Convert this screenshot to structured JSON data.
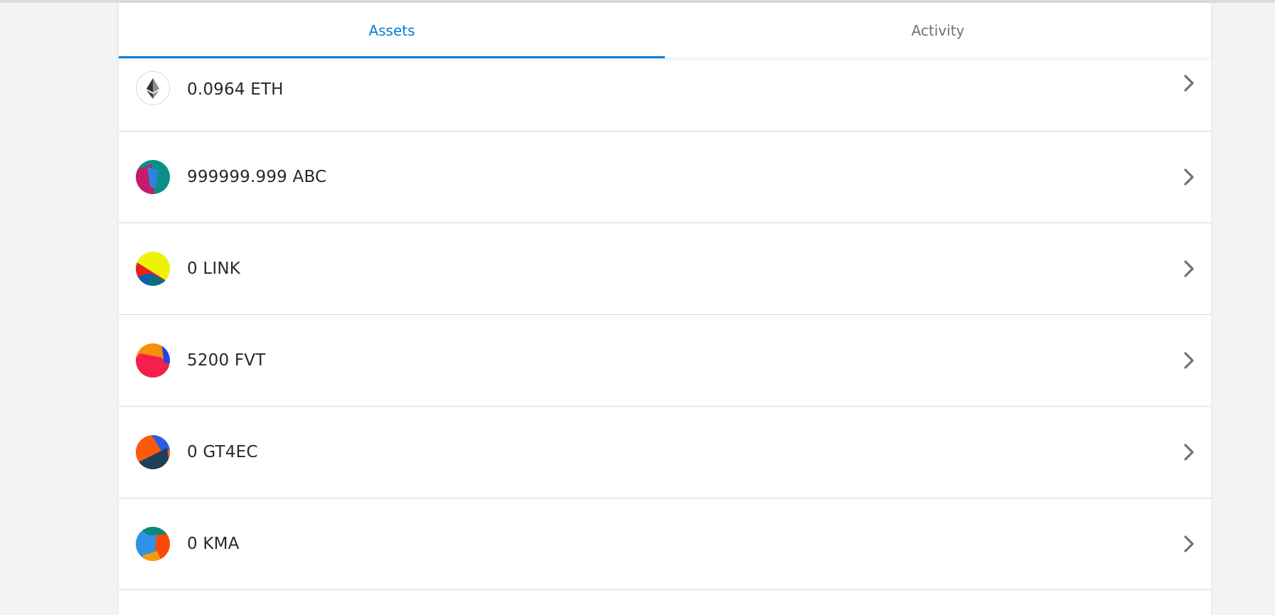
{
  "tabs": {
    "assets": "Assets",
    "activity": "Activity"
  },
  "assets": [
    {
      "amount": "0.0964 ETH",
      "icon": "ethereum-icon"
    },
    {
      "amount": "999999.999 ABC",
      "icon": "jazzicon",
      "colors": [
        "#0a8f88",
        "#c51c6b",
        "#2f82e0"
      ]
    },
    {
      "amount": "0 LINK",
      "icon": "jazzicon",
      "colors": [
        "#eef209",
        "#e8221b",
        "#125cb4",
        "#0b6f7a"
      ]
    },
    {
      "amount": "5200 FVT",
      "icon": "jazzicon",
      "colors": [
        "#f4900c",
        "#f51f4c",
        "#2345e6"
      ]
    },
    {
      "amount": "0 GT4EC",
      "icon": "jazzicon",
      "colors": [
        "#fa5a0a",
        "#1d3f5a",
        "#2c5de0"
      ]
    },
    {
      "amount": "0 KMA",
      "icon": "jazzicon",
      "colors": [
        "#fa4a0a",
        "#2e93e6",
        "#0a8a78",
        "#f59a10"
      ]
    }
  ],
  "theme": {
    "accent": "#037dd6",
    "text": "#24292e",
    "muted": "#6a737d",
    "chevron": "#6a737d"
  }
}
